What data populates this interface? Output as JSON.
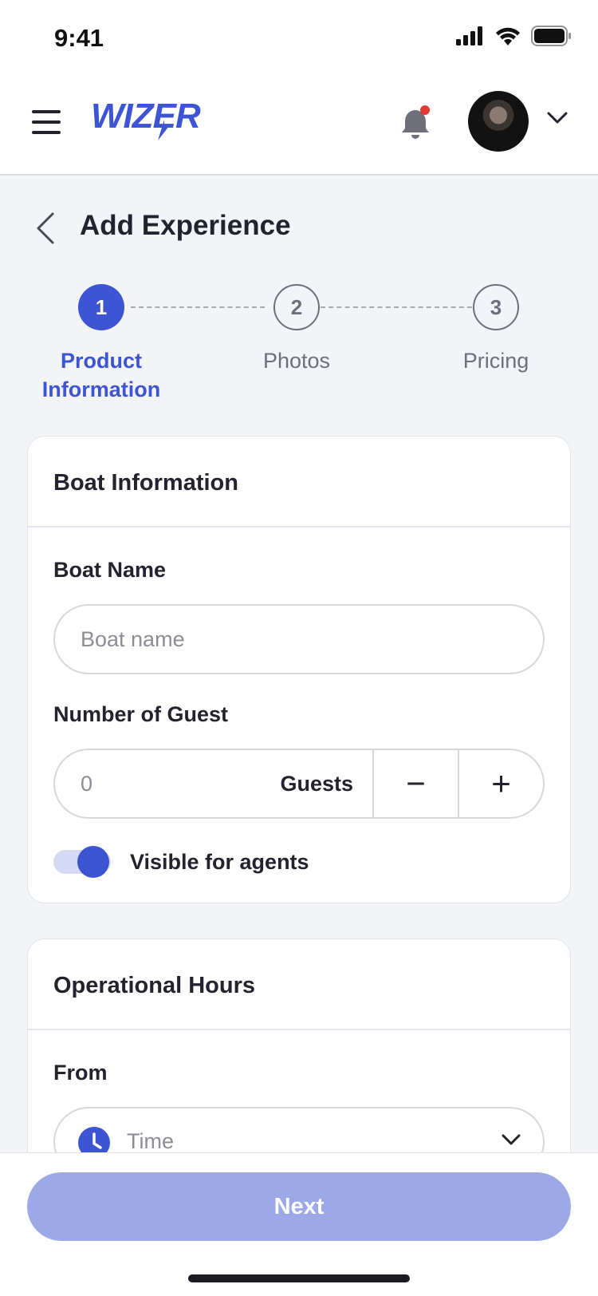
{
  "status_bar": {
    "time": "9:41"
  },
  "header": {
    "brand": "WIZER",
    "notification_dot_color": "#E53935"
  },
  "page": {
    "title": "Add Experience"
  },
  "stepper": {
    "steps": [
      {
        "number": "1",
        "label_line1": "Product",
        "label_line2": "Information",
        "state": "active"
      },
      {
        "number": "2",
        "label_line1": "Photos",
        "label_line2": "",
        "state": "inactive"
      },
      {
        "number": "3",
        "label_line1": "Pricing",
        "label_line2": "",
        "state": "inactive"
      }
    ]
  },
  "boat_card": {
    "title": "Boat Information",
    "boat_name_label": "Boat Name",
    "boat_name_placeholder": "Boat name",
    "guests_label": "Number of Guest",
    "guests_value": "0",
    "guests_unit": "Guests",
    "decrement": "−",
    "increment": "+",
    "toggle_label": "Visible for agents",
    "toggle_on": true
  },
  "hours_card": {
    "title": "Operational Hours",
    "from_label": "From",
    "from_placeholder": "Time"
  },
  "footer": {
    "next_label": "Next"
  },
  "colors": {
    "primary": "#3D54D3",
    "primary_disabled": "#9DA8E6"
  }
}
